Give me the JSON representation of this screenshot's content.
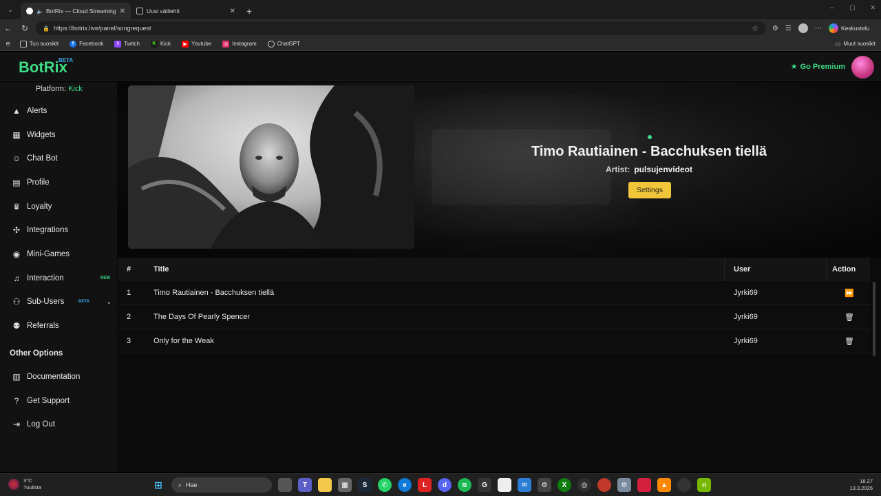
{
  "browser": {
    "tabs": [
      {
        "title": "BotRix — Cloud Streaming Bot",
        "active": true
      },
      {
        "title": "Uusi välilehti",
        "active": false
      }
    ],
    "url": "https://botrix.live/panel/songrequest",
    "copilot_label": "Keskustelu",
    "bookmarks": [
      {
        "label": "Tuo suosikit",
        "icon": "import-icon"
      },
      {
        "label": "Facebook",
        "icon": "facebook-icon",
        "color": "#1877f2"
      },
      {
        "label": "Twitch",
        "icon": "twitch-icon",
        "color": "#9146ff"
      },
      {
        "label": "Kick",
        "icon": "kick-icon",
        "color": "#53fc18"
      },
      {
        "label": "Youtube",
        "icon": "youtube-icon",
        "color": "#ff0000"
      },
      {
        "label": "Instagram",
        "icon": "instagram-icon",
        "color": "#e1306c"
      },
      {
        "label": "ChatGPT",
        "icon": "chatgpt-icon",
        "color": "#cccccc"
      }
    ],
    "other_bookmarks": "Muut suosikit"
  },
  "header": {
    "brand": "BotRix",
    "brand_badge": "BETA",
    "premium_label": "Go Premium",
    "accent": "#3ddc84"
  },
  "sidebar": {
    "platform_label": "Platform:",
    "platform_value": "Kick",
    "items": [
      {
        "label": "Alerts",
        "icon": "alert-triangle-icon"
      },
      {
        "label": "Widgets",
        "icon": "widgets-grid-icon"
      },
      {
        "label": "Chat Bot",
        "icon": "robot-icon"
      },
      {
        "label": "Profile",
        "icon": "id-card-icon"
      },
      {
        "label": "Loyalty",
        "icon": "trophy-icon"
      },
      {
        "label": "Integrations",
        "icon": "puzzle-icon"
      },
      {
        "label": "Mini-Games",
        "icon": "gamepad-icon"
      },
      {
        "label": "Interaction",
        "icon": "music-note-icon",
        "badge": "NEW"
      },
      {
        "label": "Sub-Users",
        "icon": "users-icon",
        "badge": "BETA"
      },
      {
        "label": "Referrals",
        "icon": "referrals-icon"
      }
    ],
    "other_options_title": "Other Options",
    "other_items": [
      {
        "label": "Documentation",
        "icon": "book-icon"
      },
      {
        "label": "Get Support",
        "icon": "question-circle-icon"
      },
      {
        "label": "Log Out",
        "icon": "logout-icon"
      }
    ]
  },
  "now_playing": {
    "title": "Timo Rautiainen - Bacchuksen tiellä",
    "artist_label": "Artist:",
    "artist": "pulsujenvideot",
    "settings_label": "Settings"
  },
  "queue": {
    "columns": [
      "#",
      "Title",
      "User",
      "Action"
    ],
    "rows": [
      {
        "num": "1",
        "title": "Timo Rautiainen - Bacchuksen tiellä",
        "user": "Jyrki69",
        "action": "skip-icon"
      },
      {
        "num": "2",
        "title": "The Days Of Pearly Spencer",
        "user": "Jyrki69",
        "action": "trash-icon"
      },
      {
        "num": "3",
        "title": "Only for the Weak",
        "user": "Jyrki69",
        "action": "trash-icon"
      }
    ]
  },
  "taskbar": {
    "temperature": "3°C",
    "weather": "Tuulista",
    "search_placeholder": "Hae",
    "time": "18.27",
    "date": "13.3.2026"
  }
}
